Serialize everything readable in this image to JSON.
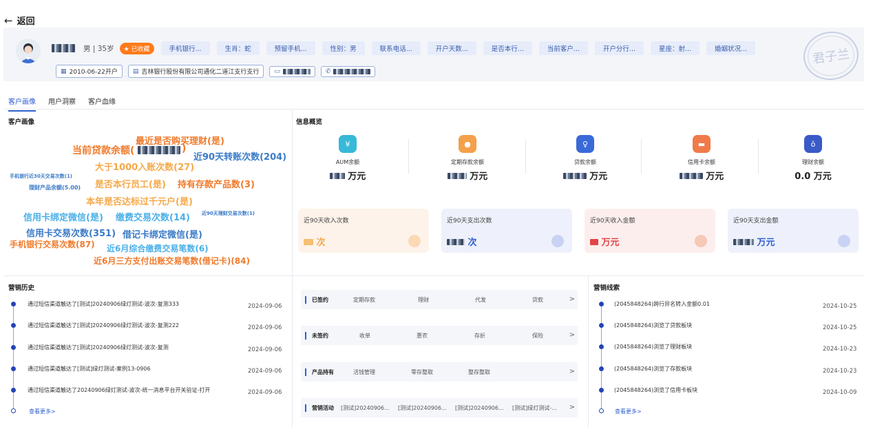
{
  "back": {
    "label": "返回"
  },
  "profile": {
    "gender_age": "男 | 35岁",
    "fav_badge": "★ 已收藏",
    "tags": [
      "手机银行...",
      "生肖：蛇",
      "预留手机...",
      "性别：男",
      "联系电话...",
      "开户天数...",
      "是否本行...",
      "当前客户...",
      "开户分行...",
      "星座：射...",
      "婚姻状况..."
    ],
    "open_date": "2010-06-22开户",
    "branch": "吉林银行股份有限公司通化二道江支行支行",
    "stamp": "君子兰"
  },
  "tabs": [
    "客户画像",
    "用户洞察",
    "客户血缘"
  ],
  "portrait": {
    "title": "客户画像",
    "words": [
      {
        "text": "最近是否购买理财(是)",
        "color": "#f07a2a",
        "size": 13
      },
      {
        "text": "当前贷款余额(",
        "color": "#f07a2a",
        "size": 14
      },
      {
        "text": ")",
        "color": "#f07a2a",
        "size": 14
      },
      {
        "text": "近90天转账次数(204)",
        "color": "#3a7ac8",
        "size": 13
      },
      {
        "text": "大于1000入账次数(27)",
        "color": "#f5a94a",
        "size": 13
      },
      {
        "text": "手机银行近30天交易次数(1)",
        "color": "#3a7ac8",
        "size": 7
      },
      {
        "text": "是否本行员工(是)",
        "color": "#f5a94a",
        "size": 13
      },
      {
        "text": "持有存款产品数(3)",
        "color": "#f07a2a",
        "size": 13
      },
      {
        "text": "理财产品余额(5.00)",
        "color": "#3a7ac8",
        "size": 8
      },
      {
        "text": "本年是否达标过千元户(是)",
        "color": "#f5a94a",
        "size": 13
      },
      {
        "text": "信用卡绑定微信(是)",
        "color": "#4ab0e8",
        "size": 13
      },
      {
        "text": "缴费交易次数(14)",
        "color": "#4ab0e8",
        "size": 13
      },
      {
        "text": "近90天理财交易次数(1)",
        "color": "#3a7ac8",
        "size": 7
      },
      {
        "text": "信用卡交易次数(351)",
        "color": "#3a7ac8",
        "size": 13
      },
      {
        "text": "借记卡绑定微信(是)",
        "color": "#3a7ac8",
        "size": 13
      },
      {
        "text": "手机银行交易次数(87)",
        "color": "#f07a2a",
        "size": 12
      },
      {
        "text": "近6月综合缴费交易笔数(6)",
        "color": "#4ab0e8",
        "size": 12
      },
      {
        "text": "近6月三方支付出账交易笔数(借记卡)(84)",
        "color": "#f07a2a",
        "size": 12
      }
    ]
  },
  "overview": {
    "title": "信息概览",
    "metrics": [
      {
        "label": "AUM余额",
        "unit": "万元",
        "icon": "wallet-icon",
        "color": "#38b8d8"
      },
      {
        "label": "定期存款余额",
        "unit": "万元",
        "icon": "piggy-icon",
        "color": "#f5a04a"
      },
      {
        "label": "贷款余额",
        "unit": "万元",
        "icon": "loan-icon",
        "color": "#3a6ad8"
      },
      {
        "label": "信用卡余额",
        "unit": "万元",
        "icon": "card-icon",
        "color": "#f07a4a"
      },
      {
        "label": "理财余额",
        "value": "0.0 万元",
        "icon": "moneybag-icon",
        "color": "#3a5ac8"
      }
    ],
    "cards": [
      {
        "label": "近90天收入次数",
        "unit": "次",
        "bg": "#fdf3ea",
        "dot": "#fbd9b5",
        "vcolor": "#f5a94a"
      },
      {
        "label": "近90天支出次数",
        "unit": "次",
        "bg": "#eef1fb",
        "dot": "#c8d3f3",
        "vcolor": "#2f5fd0"
      },
      {
        "label": "近90天收入金额",
        "unit": "万元",
        "bg": "#fdeeee",
        "dot": "#f6c8b6",
        "vcolor": "#e04646"
      },
      {
        "label": "近90天支出金额",
        "unit": "万元",
        "bg": "#eef1fb",
        "dot": "#c8d3f3",
        "vcolor": "#2f5fd0"
      }
    ]
  },
  "history": {
    "title": "营销历史",
    "items": [
      {
        "text": "通过短信渠道触达了[测试]20240906绿灯测试-波次-复测333",
        "date": "2024-09-06"
      },
      {
        "text": "通过短信渠道触达了[测试]20240906绿灯测试-波次-复测222",
        "date": "2024-09-06"
      },
      {
        "text": "通过短信渠道触达了[测试]20240906绿灯测试-波次-复测",
        "date": "2024-09-06"
      },
      {
        "text": "通过短信渠道触达了[测试]绿灯测试-案例13-0906",
        "date": "2024-09-06"
      },
      {
        "text": "通过短信渠道触达了20240906绿灯测试-波次-统一消息平台开关验证-打开",
        "date": "2024-09-06"
      }
    ],
    "more": "查看更多>"
  },
  "products": [
    {
      "label": "已签约",
      "items": [
        "定期存款",
        "理财",
        "代发",
        "贷款"
      ],
      "arrow": ">"
    },
    {
      "label": "未签约",
      "items": [
        "收单",
        "惠农",
        "存折",
        "保险"
      ],
      "arrow": ">"
    },
    {
      "label": "产品持有",
      "items": [
        "活钱管理",
        "零存整取",
        "整存整取"
      ],
      "arrow": ">"
    },
    {
      "label": "营销活动",
      "items": [
        "[测试]20240906...",
        "[测试]20240906...",
        "[测试]20240906...",
        "[测试]绿灯测试-..."
      ],
      "arrow": ">"
    }
  ],
  "leads": {
    "title": "营销线索",
    "items": [
      {
        "text": "(2045848264)跨行异名转入金额0.01",
        "date": "2024-10-25"
      },
      {
        "text": "(2045848264)浏览了贷款板块",
        "date": "2024-10-25"
      },
      {
        "text": "(2045848264)浏览了理财板块",
        "date": "2024-10-23"
      },
      {
        "text": "(2045848264)浏览了存款板块",
        "date": "2024-10-23"
      },
      {
        "text": "(2045848264)浏览了信用卡板块",
        "date": "2024-10-09"
      }
    ],
    "more": "查看更多>"
  }
}
